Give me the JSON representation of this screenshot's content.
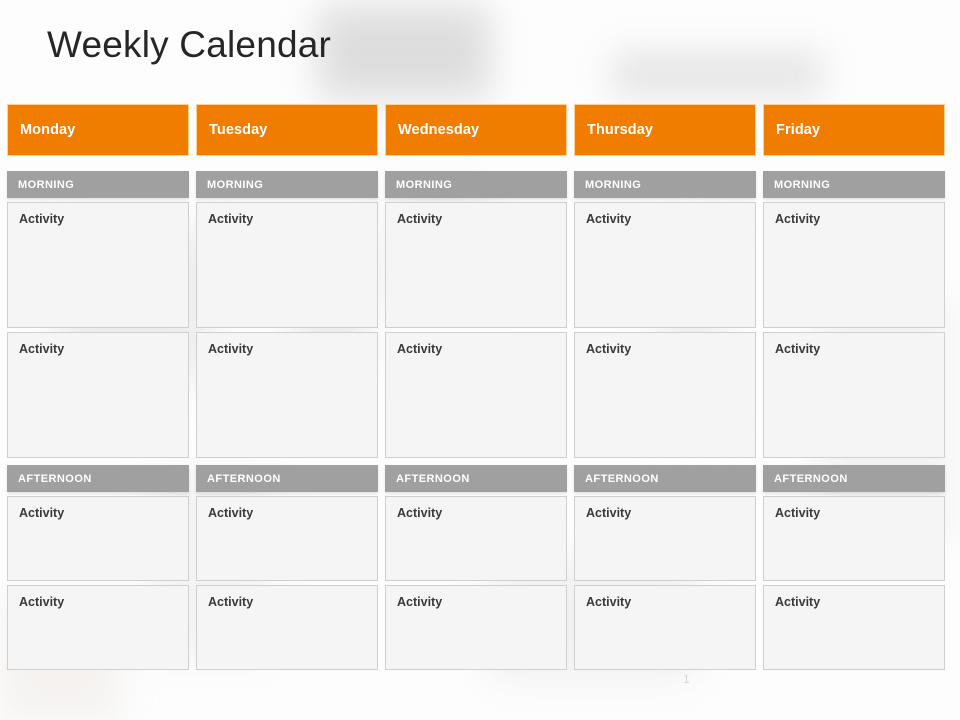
{
  "page": {
    "title": "Weekly Calendar",
    "page_number": "1",
    "accent_color": "#F07D00",
    "slot_bar_color": "#A0A0A0",
    "activity_bg_color": "#F5F5F5",
    "title_color": "#262626"
  },
  "columns": [
    {
      "day": "Monday",
      "sections": [
        {
          "label": "MORNING",
          "activities": [
            "Activity",
            "Activity"
          ]
        },
        {
          "label": "AFTERNOON",
          "activities": [
            "Activity",
            "Activity"
          ]
        }
      ]
    },
    {
      "day": "Tuesday",
      "sections": [
        {
          "label": "MORNING",
          "activities": [
            "Activity",
            "Activity"
          ]
        },
        {
          "label": "AFTERNOON",
          "activities": [
            "Activity",
            "Activity"
          ]
        }
      ]
    },
    {
      "day": "Wednesday",
      "sections": [
        {
          "label": "MORNING",
          "activities": [
            "Activity",
            "Activity"
          ]
        },
        {
          "label": "AFTERNOON",
          "activities": [
            "Activity",
            "Activity"
          ]
        }
      ]
    },
    {
      "day": "Thursday",
      "sections": [
        {
          "label": "MORNING",
          "activities": [
            "Activity",
            "Activity"
          ]
        },
        {
          "label": "AFTERNOON",
          "activities": [
            "Activity",
            "Activity"
          ]
        }
      ]
    },
    {
      "day": "Friday",
      "sections": [
        {
          "label": "MORNING",
          "activities": [
            "Activity",
            "Activity"
          ]
        },
        {
          "label": "AFTERNOON",
          "activities": [
            "Activity",
            "Activity"
          ]
        }
      ]
    }
  ]
}
